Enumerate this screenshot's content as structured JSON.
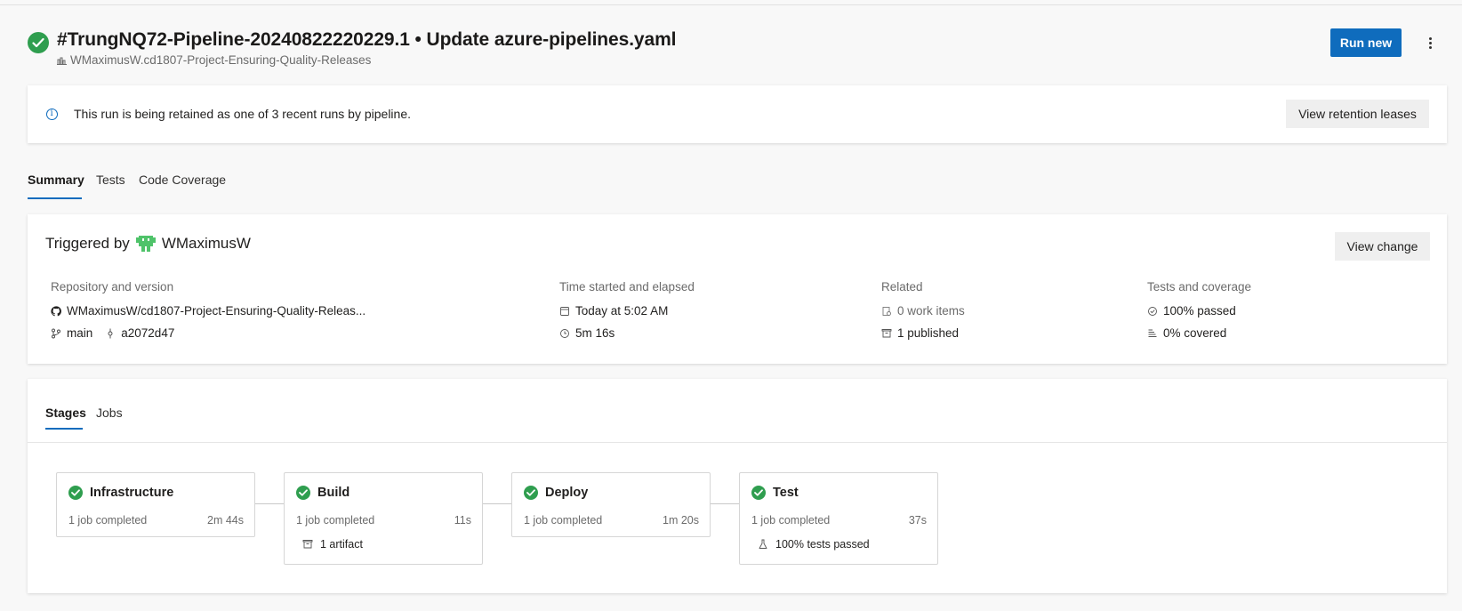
{
  "header": {
    "run_title": "#TrungNQ72-Pipeline-20240822220229.1 • Update azure-pipelines.yaml",
    "pipeline_name": "WMaximusW.cd1807-Project-Ensuring-Quality-Releases",
    "run_new_label": "Run new"
  },
  "banner": {
    "message": "This run is being retained as one of 3 recent runs by pipeline.",
    "button_label": "View retention leases"
  },
  "tabs": [
    {
      "label": "Summary",
      "active": true
    },
    {
      "label": "Tests",
      "active": false
    },
    {
      "label": "Code Coverage",
      "active": false
    }
  ],
  "triggered": {
    "prefix": "Triggered by",
    "user": "WMaximusW",
    "view_change_label": "View change",
    "repository": {
      "heading": "Repository and version",
      "repo": "WMaximusW/cd1807-Project-Ensuring-Quality-Releas...",
      "branch": "main",
      "commit": "a2072d47"
    },
    "time": {
      "heading": "Time started and elapsed",
      "started": "Today at 5:02 AM",
      "elapsed": "5m 16s"
    },
    "related": {
      "heading": "Related",
      "work_items": "0 work items",
      "published": "1 published"
    },
    "tests": {
      "heading": "Tests and coverage",
      "passed": "100% passed",
      "covered": "0% covered"
    }
  },
  "stage_tabs": [
    {
      "label": "Stages",
      "active": true
    },
    {
      "label": "Jobs",
      "active": false
    }
  ],
  "stages": [
    {
      "name": "Infrastructure",
      "status": "1 job completed",
      "duration": "2m 44s",
      "extra": ""
    },
    {
      "name": "Build",
      "status": "1 job completed",
      "duration": "11s",
      "extra": "1 artifact"
    },
    {
      "name": "Deploy",
      "status": "1 job completed",
      "duration": "1m 20s",
      "extra": ""
    },
    {
      "name": "Test",
      "status": "1 job completed",
      "duration": "37s",
      "extra": "100% tests passed"
    }
  ],
  "colors": {
    "accent": "#0f6cbd",
    "success": "#2f9e4f",
    "avatar": "#4fc36a"
  }
}
